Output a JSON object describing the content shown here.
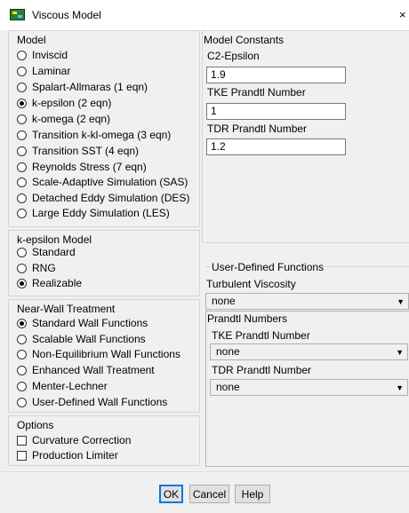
{
  "window": {
    "title": "Viscous Model",
    "close_glyph": "×"
  },
  "model": {
    "title": "Model",
    "options": [
      {
        "label": "Inviscid",
        "selected": false
      },
      {
        "label": "Laminar",
        "selected": false
      },
      {
        "label": "Spalart-Allmaras (1 eqn)",
        "selected": false
      },
      {
        "label": "k-epsilon (2 eqn)",
        "selected": true
      },
      {
        "label": "k-omega (2 eqn)",
        "selected": false
      },
      {
        "label": "Transition k-kl-omega (3 eqn)",
        "selected": false
      },
      {
        "label": "Transition SST (4 eqn)",
        "selected": false
      },
      {
        "label": "Reynolds Stress (7 eqn)",
        "selected": false
      },
      {
        "label": "Scale-Adaptive Simulation (SAS)",
        "selected": false
      },
      {
        "label": "Detached Eddy Simulation (DES)",
        "selected": false
      },
      {
        "label": "Large Eddy Simulation (LES)",
        "selected": false
      }
    ]
  },
  "kepsilon": {
    "title": "k-epsilon Model",
    "options": [
      {
        "label": "Standard",
        "selected": false
      },
      {
        "label": "RNG",
        "selected": false
      },
      {
        "label": "Realizable",
        "selected": true
      }
    ]
  },
  "nearwall": {
    "title": "Near-Wall Treatment",
    "options": [
      {
        "label": "Standard Wall Functions",
        "selected": true
      },
      {
        "label": "Scalable Wall Functions",
        "selected": false
      },
      {
        "label": "Non-Equilibrium Wall Functions",
        "selected": false
      },
      {
        "label": "Enhanced Wall Treatment",
        "selected": false
      },
      {
        "label": "Menter-Lechner",
        "selected": false
      },
      {
        "label": "User-Defined Wall Functions",
        "selected": false
      }
    ]
  },
  "options": {
    "title": "Options",
    "items": [
      {
        "label": "Curvature Correction",
        "checked": false
      },
      {
        "label": "Production Limiter",
        "checked": false
      }
    ]
  },
  "constants": {
    "title": "Model Constants",
    "fields": [
      {
        "label": "C2-Epsilon",
        "value": "1.9"
      },
      {
        "label": "TKE Prandtl Number",
        "value": "1"
      },
      {
        "label": "TDR Prandtl Number",
        "value": "1.2"
      }
    ]
  },
  "udf": {
    "title": "User-Defined Functions",
    "turbulent_viscosity_label": "Turbulent Viscosity",
    "turbulent_viscosity_value": "none",
    "prandtl_title": "Prandtl Numbers",
    "tke_label": "TKE Prandtl Number",
    "tke_value": "none",
    "tdr_label": "TDR Prandtl Number",
    "tdr_value": "none",
    "arrow": "▼"
  },
  "buttons": {
    "ok": "OK",
    "cancel": "Cancel",
    "help": "Help"
  }
}
